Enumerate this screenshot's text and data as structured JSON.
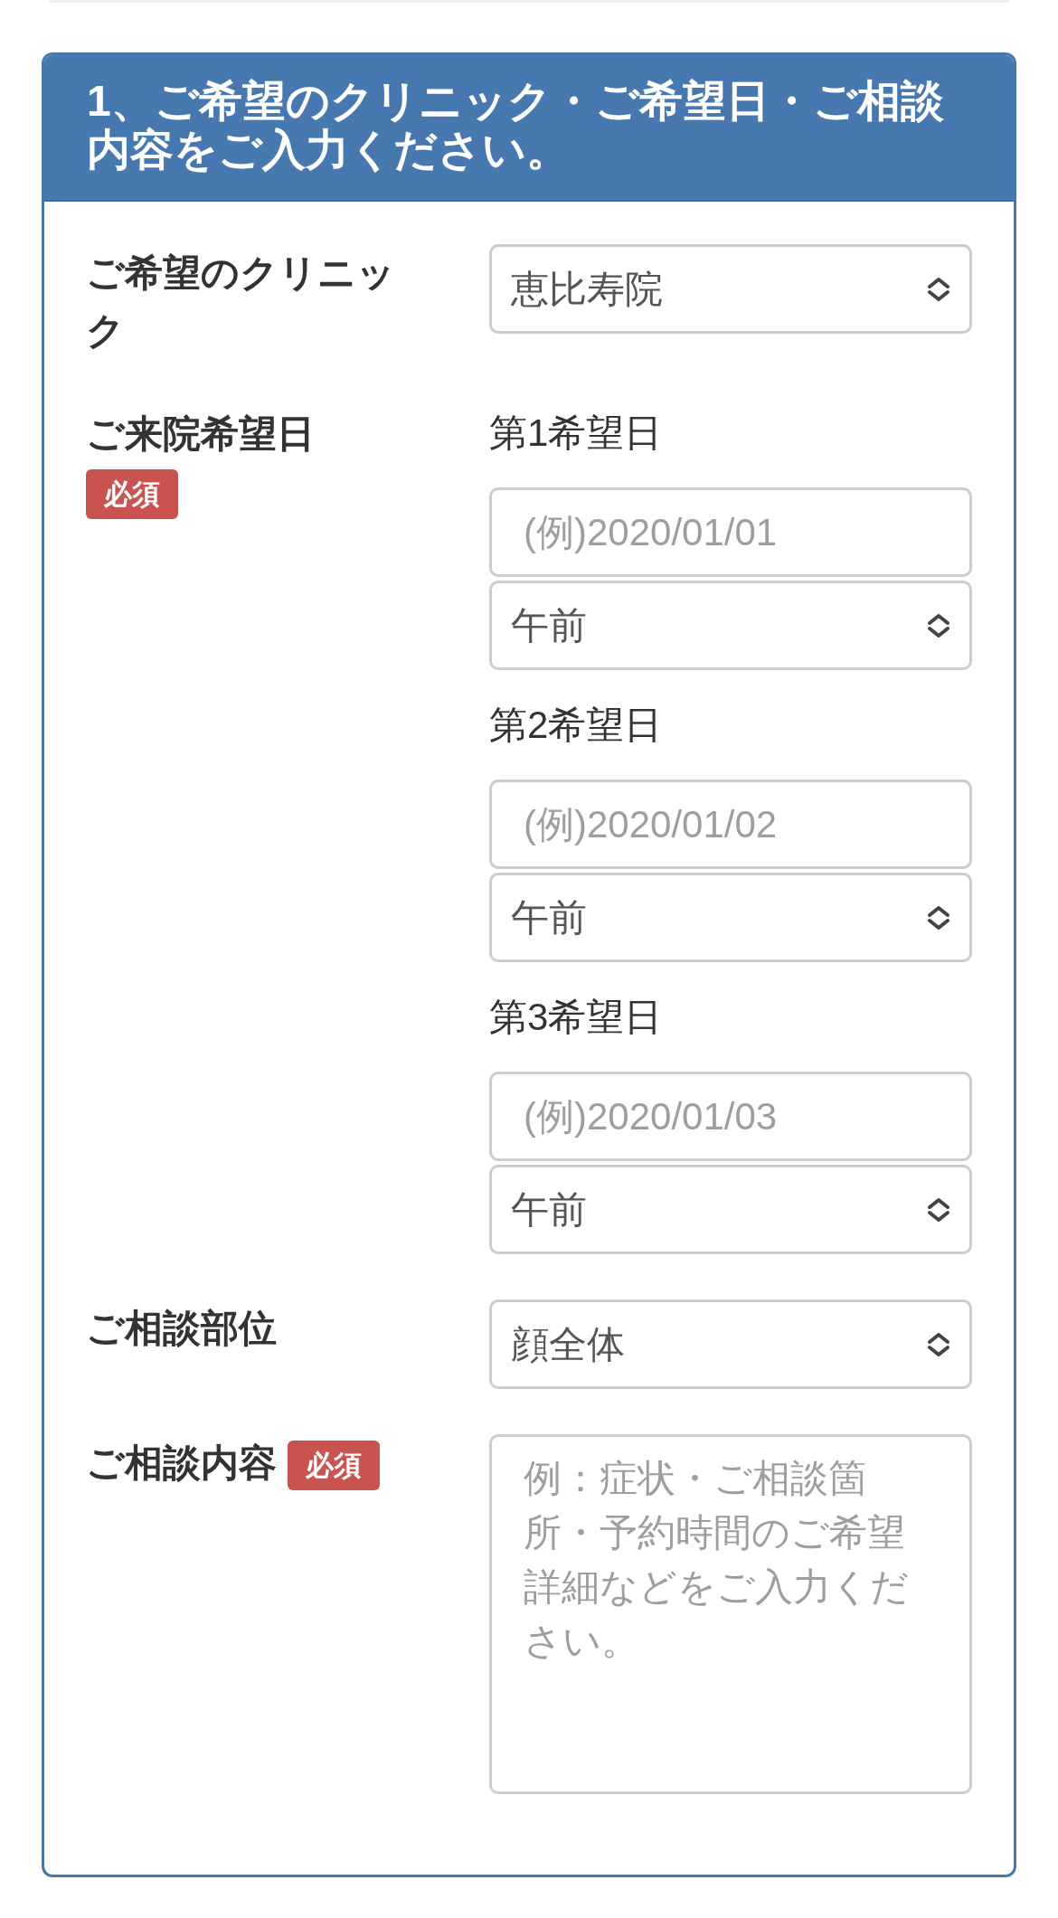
{
  "section": {
    "title": "1、ご希望のクリニック・ご希望日・ご相談内容をご入力ください。",
    "fields": [
      {
        "kind": "select",
        "label": "ご希望のクリニック",
        "value": "恵比寿院"
      },
      {
        "kind": "dates",
        "label": "ご来院希望日",
        "badge": "必須",
        "choices": [
          {
            "label": "第1希望日",
            "date_placeholder": "(例)2020/01/01",
            "time": "午前"
          },
          {
            "label": "第2希望日",
            "date_placeholder": "(例)2020/01/02",
            "time": "午前"
          },
          {
            "label": "第3希望日",
            "date_placeholder": "(例)2020/01/03",
            "time": "午前"
          }
        ]
      },
      {
        "kind": "select",
        "label": "ご相談部位",
        "value": "顔全体"
      },
      {
        "kind": "textarea",
        "label": "ご相談内容",
        "badge": "必須",
        "placeholder": "例：症状・ご相談箇所・予約時間のご希望詳細などをご入力ください。"
      }
    ]
  }
}
